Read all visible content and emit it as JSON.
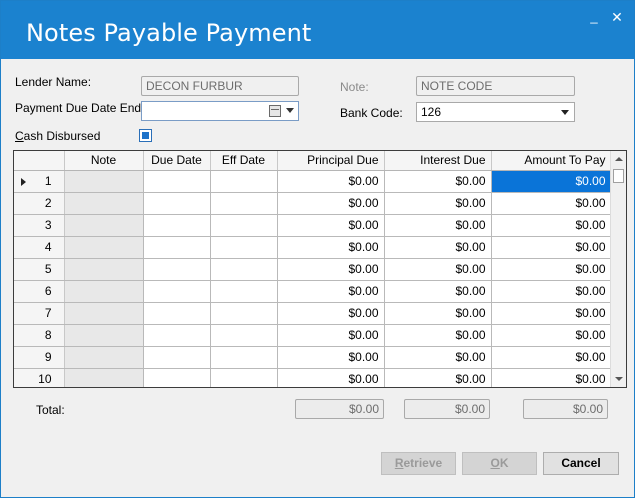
{
  "window": {
    "title": "Notes Payable Payment",
    "minimize_glyph": "_",
    "close_glyph": "✕"
  },
  "form": {
    "lender_name_label": "Lender Name:",
    "lender_name_value": "DECON FURBUR",
    "note_label": "Note:",
    "note_value": "NOTE CODE",
    "payment_due_label": "Payment Due Date End:",
    "payment_due_value": "",
    "bank_code_label": "Bank Code:",
    "bank_code_value": "126",
    "cash_disbursed_label": "Cash Disbursed",
    "cash_disbursed_checked": true
  },
  "grid": {
    "columns": [
      "Note",
      "Due Date",
      "Eff Date",
      "Principal Due",
      "Interest Due",
      "Amount To Pay"
    ],
    "rows": [
      {
        "num": "1",
        "note": "",
        "due_date": "",
        "eff_date": "",
        "principal_due": "$0.00",
        "interest_due": "$0.00",
        "amount_to_pay": "$0.00"
      },
      {
        "num": "2",
        "note": "",
        "due_date": "",
        "eff_date": "",
        "principal_due": "$0.00",
        "interest_due": "$0.00",
        "amount_to_pay": "$0.00"
      },
      {
        "num": "3",
        "note": "",
        "due_date": "",
        "eff_date": "",
        "principal_due": "$0.00",
        "interest_due": "$0.00",
        "amount_to_pay": "$0.00"
      },
      {
        "num": "4",
        "note": "",
        "due_date": "",
        "eff_date": "",
        "principal_due": "$0.00",
        "interest_due": "$0.00",
        "amount_to_pay": "$0.00"
      },
      {
        "num": "5",
        "note": "",
        "due_date": "",
        "eff_date": "",
        "principal_due": "$0.00",
        "interest_due": "$0.00",
        "amount_to_pay": "$0.00"
      },
      {
        "num": "6",
        "note": "",
        "due_date": "",
        "eff_date": "",
        "principal_due": "$0.00",
        "interest_due": "$0.00",
        "amount_to_pay": "$0.00"
      },
      {
        "num": "7",
        "note": "",
        "due_date": "",
        "eff_date": "",
        "principal_due": "$0.00",
        "interest_due": "$0.00",
        "amount_to_pay": "$0.00"
      },
      {
        "num": "8",
        "note": "",
        "due_date": "",
        "eff_date": "",
        "principal_due": "$0.00",
        "interest_due": "$0.00",
        "amount_to_pay": "$0.00"
      },
      {
        "num": "9",
        "note": "",
        "due_date": "",
        "eff_date": "",
        "principal_due": "$0.00",
        "interest_due": "$0.00",
        "amount_to_pay": "$0.00"
      },
      {
        "num": "10",
        "note": "",
        "due_date": "",
        "eff_date": "",
        "principal_due": "$0.00",
        "interest_due": "$0.00",
        "amount_to_pay": "$0.00"
      }
    ],
    "selected_row": 0,
    "selected_column": "amount_to_pay"
  },
  "totals": {
    "label": "Total:",
    "principal_due": "$0.00",
    "interest_due": "$0.00",
    "amount_to_pay": "$0.00"
  },
  "buttons": {
    "retrieve": "Retrieve",
    "ok": "OK",
    "cancel": "Cancel"
  },
  "colors": {
    "titlebar": "#1b82cf",
    "selection": "#0a74d8"
  },
  "icons": {
    "calendar": "calendar-icon",
    "dropdown": "chevron-down-icon",
    "row_indicator": "current-row-arrow-icon"
  }
}
